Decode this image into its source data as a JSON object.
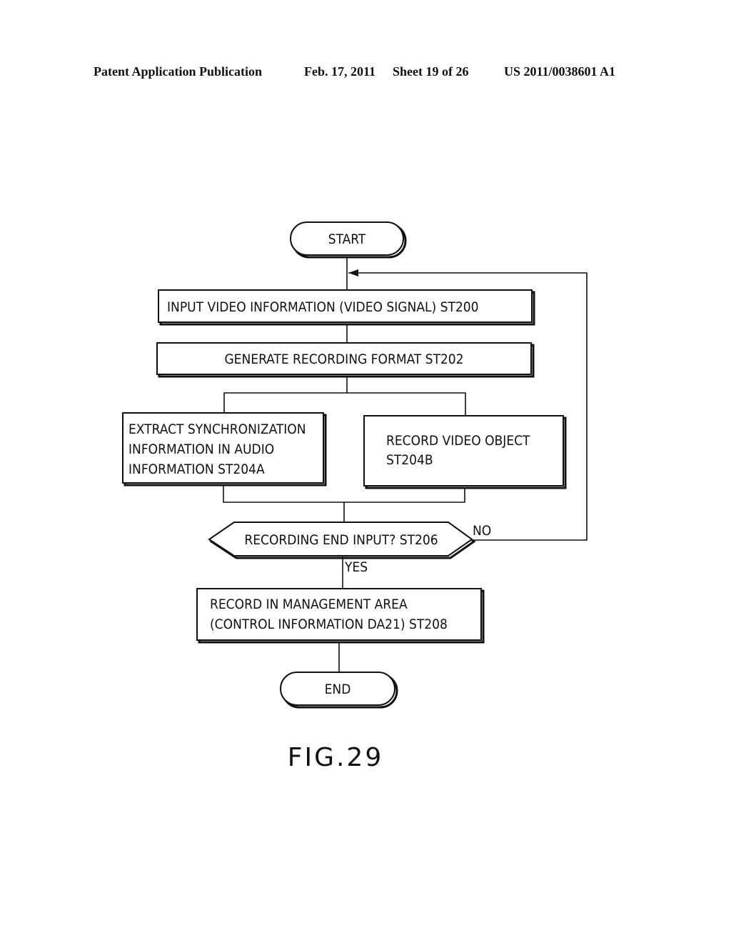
{
  "header": {
    "publication": "Patent Application Publication",
    "date": "Feb. 17, 2011",
    "sheet": "Sheet 19 of 26",
    "number": "US 2011/0038601 A1"
  },
  "flowchart": {
    "start": "START",
    "st200": "INPUT VIDEO INFORMATION (VIDEO SIGNAL) ST200",
    "st202": "GENERATE RECORDING FORMAT ST202",
    "st204a": [
      "EXTRACT SYNCHRONIZATION",
      "INFORMATION IN AUDIO",
      "INFORMATION ST204A"
    ],
    "st204b": [
      "RECORD VIDEO OBJECT",
      "ST204B"
    ],
    "st206": "RECORDING END INPUT? ST206",
    "no_label": "NO",
    "yes_label": "YES",
    "st208": [
      "RECORD IN MANAGEMENT AREA",
      "(CONTROL INFORMATION DA21) ST208"
    ],
    "end": "END"
  },
  "figure_label": "FIG.29"
}
